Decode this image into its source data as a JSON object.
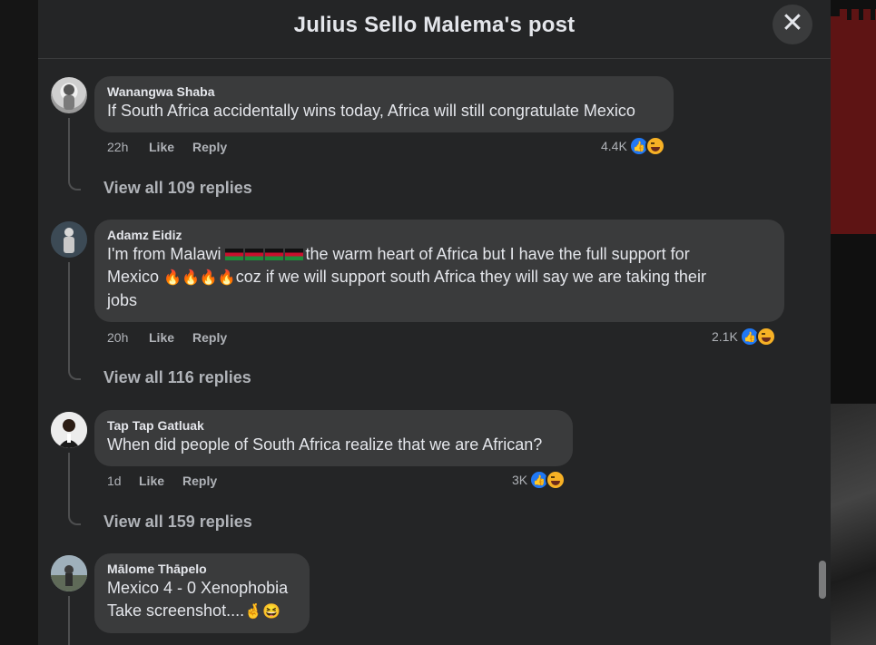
{
  "modal": {
    "title": "Julius Sello Malema's post",
    "close_icon": "close-icon"
  },
  "comments": [
    {
      "author": "Wanangwa Shaba",
      "text": "If South Africa accidentally wins today, Africa will still congratulate Mexico",
      "time": "22h",
      "like_label": "Like",
      "reply_label": "Reply",
      "reaction_count": "4.4K",
      "reactions": [
        "like-icon",
        "haha-icon"
      ],
      "view_replies": "View all 109 replies"
    },
    {
      "author": "Adamz Eidiz",
      "text_part1": "I'm from Malawi",
      "text_part2": "the warm heart of Africa but I have the full support for",
      "text_part3": "Mexico",
      "text_part4": "coz if we will support south Africa they will say we are taking their",
      "text_part5": "jobs",
      "time": "20h",
      "like_label": "Like",
      "reply_label": "Reply",
      "reaction_count": "2.1K",
      "reactions": [
        "like-icon",
        "haha-icon"
      ],
      "view_replies": "View all 116 replies"
    },
    {
      "author": "Tap Tap Gatluak",
      "text": "When did people of South Africa realize that we are African?",
      "time": "1d",
      "like_label": "Like",
      "reply_label": "Reply",
      "reaction_count": "3K",
      "reactions": [
        "like-icon",
        "haha-icon"
      ],
      "view_replies": "View all 159 replies"
    },
    {
      "author": "Mālome Thāpelo",
      "line1": "Mexico 4 - 0 Xenophobia",
      "line2": "Take screenshot....",
      "line2_emoji": "🤞😆"
    }
  ],
  "colors": {
    "modal_bg": "#242526",
    "bubble_bg": "#3a3b3c",
    "text_primary": "#e4e6eb",
    "text_secondary": "#b0b3b8",
    "like_blue": "#2078f4",
    "haha_yellow": "#f7b125"
  }
}
